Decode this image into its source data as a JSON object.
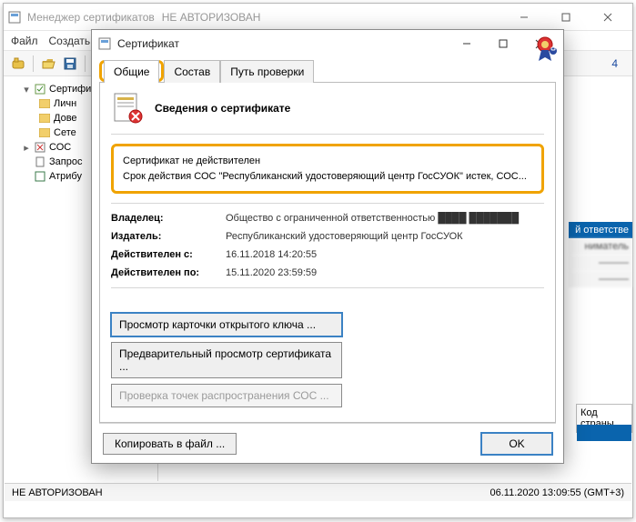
{
  "main_window": {
    "title": "Менеджер сертификатов",
    "title_suffix": "НЕ АВТОРИЗОВАН",
    "menu": {
      "file": "Файл",
      "create": "Создать"
    }
  },
  "toolbar": {
    "count": "4"
  },
  "tree": {
    "root": "Сертифи",
    "items": [
      "Личн",
      "Дове",
      "Сете"
    ],
    "coc": "СОС",
    "req": "Запрос",
    "attr": "Атрибу"
  },
  "right_rows": {
    "a": "й ответстве",
    "b": "ниматель"
  },
  "grid2_header": "Код страны",
  "statusbar": {
    "left": "НЕ АВТОРИЗОВАН",
    "right": "06.11.2020 13:09:55 (GMT+3)"
  },
  "dialog": {
    "title": "Сертификат",
    "tabs": {
      "general": "Общие",
      "contents": "Состав",
      "path": "Путь проверки"
    },
    "header": "Сведения о сертификате",
    "warn_line1": "Сертификат не действителен",
    "warn_line2": "Срок действия СОС \"Республиканский удостоверяющий центр ГосСУОК\" истек, СОС...",
    "fields": {
      "owner_label": "Владелец:",
      "owner_value": "Общество с ограниченной ответственностью",
      "issuer_label": "Издатель:",
      "issuer_value": "Республиканский удостоверяющий центр ГосСУОК",
      "valid_from_label": "Действителен с:",
      "valid_from_value": "16.11.2018 14:20:55",
      "valid_to_label": "Действителен по:",
      "valid_to_value": "15.11.2020 23:59:59"
    },
    "buttons": {
      "view_key": "Просмотр карточки открытого ключа ...",
      "preview": "Предварительный просмотр сертификата ...",
      "check_crl": "Проверка точек распространения СОС  ...",
      "copy": "Копировать в файл ...",
      "ok": "OK"
    }
  }
}
